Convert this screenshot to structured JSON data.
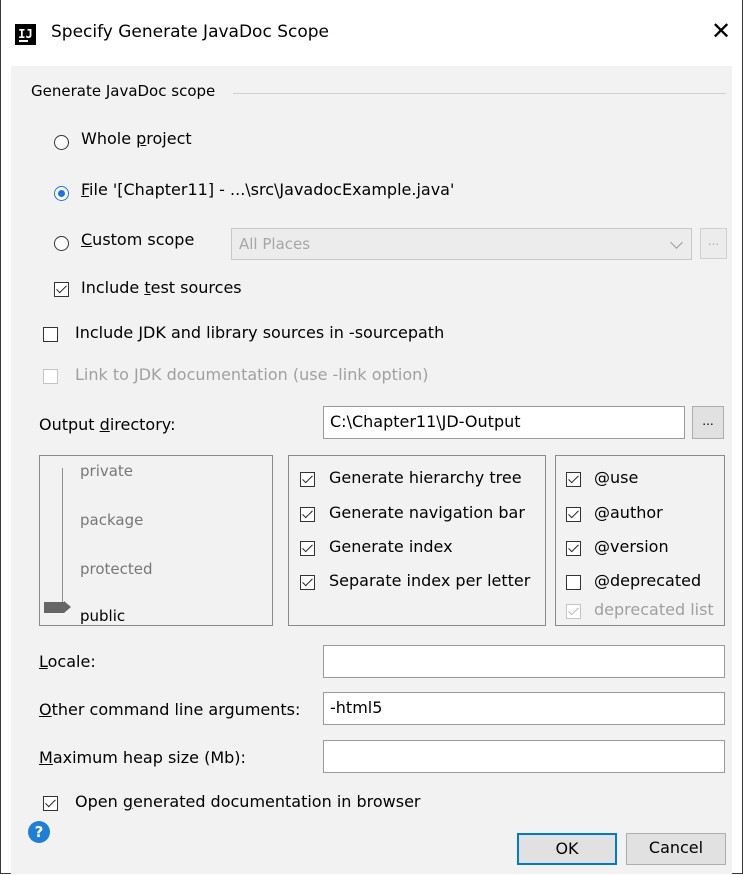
{
  "window": {
    "icon_text": "IJ",
    "title": "Specify Generate JavaDoc Scope",
    "close": "✕"
  },
  "scope_group": {
    "title": "Generate JavaDoc scope",
    "whole_project": {
      "pre": "Whole ",
      "mnemonic": "p",
      "post": "roject",
      "checked": false
    },
    "file": {
      "mnemonic": "F",
      "post": "ile '[Chapter11] - ...\\src\\JavadocExample.java'",
      "checked": true
    },
    "custom": {
      "mnemonic": "C",
      "post": "ustom scope",
      "checked": false,
      "value": "All Places",
      "browse": "..."
    },
    "include_test": {
      "pre": "Include ",
      "mnemonic": "t",
      "post": "est sources",
      "checked": true
    }
  },
  "include_jdk": {
    "label": "Include JDK and library sources in -sourcepath",
    "checked": false
  },
  "link_jdk": {
    "label": "Link to JDK documentation (use -link option)",
    "checked": false,
    "enabled": false
  },
  "output": {
    "pre": "Output ",
    "mnemonic": "d",
    "post": "irectory:",
    "value": "C:\\Chapter11\\JD-Output",
    "browse": "..."
  },
  "visibility": {
    "levels": [
      "private",
      "package",
      "protected",
      "public"
    ],
    "selected": "public"
  },
  "generate_options": [
    {
      "label": "Generate hierarchy tree",
      "checked": true
    },
    {
      "label": "Generate navigation bar",
      "checked": true
    },
    {
      "label": "Generate index",
      "checked": true
    },
    {
      "label": "Separate index per letter",
      "checked": true
    }
  ],
  "tag_options": [
    {
      "label": "@use",
      "checked": true,
      "enabled": true
    },
    {
      "label": "@author",
      "checked": true,
      "enabled": true
    },
    {
      "label": "@version",
      "checked": true,
      "enabled": true
    },
    {
      "label": "@deprecated",
      "checked": false,
      "enabled": true
    },
    {
      "label": "deprecated list",
      "checked": true,
      "enabled": false
    }
  ],
  "locale": {
    "mnemonic": "L",
    "post": "ocale:",
    "value": ""
  },
  "other_args": {
    "mnemonic": "O",
    "post": "ther command line arguments:",
    "value": "-html5"
  },
  "heap": {
    "mnemonic": "M",
    "post": "aximum heap size (Mb):",
    "value": ""
  },
  "open_browser": {
    "pre": "Open ",
    "mnemonic": "g",
    "post": "enerated documentation in browser",
    "checked": true
  },
  "buttons": {
    "help": "?",
    "ok": "OK",
    "cancel": "Cancel"
  },
  "colors": {
    "accent": "#0078d7",
    "radio_selected": "#1a73e8",
    "dialog_bg": "#f2f2f2"
  }
}
